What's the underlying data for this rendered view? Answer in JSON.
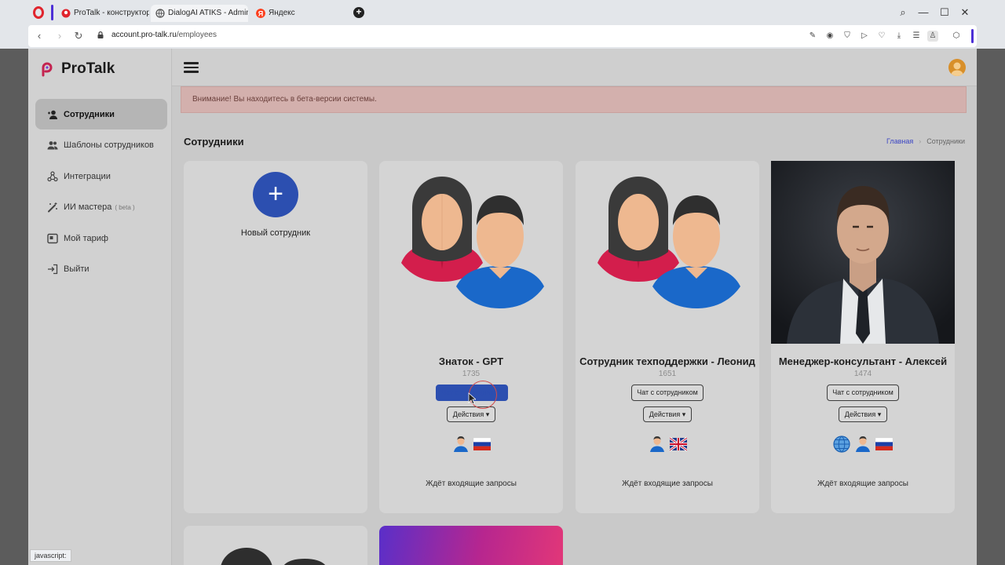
{
  "browser": {
    "tabs": [
      {
        "label": "ProTalk - конструктор GP"
      },
      {
        "label": "DialogAI ATIKS - Admin P"
      },
      {
        "label": "Яндекс"
      }
    ],
    "url_host": "account.pro-talk.ru",
    "url_path": "/employees",
    "status_text": "javascript:"
  },
  "brand": {
    "name": "ProTalk"
  },
  "sidebar": {
    "items": [
      {
        "label": "Сотрудники",
        "icon": "user-add-icon",
        "active": true
      },
      {
        "label": "Шаблоны сотрудников",
        "icon": "users-icon"
      },
      {
        "label": "Интеграции",
        "icon": "integrations-icon"
      },
      {
        "label": "ИИ мастера",
        "badge": "( beta )",
        "icon": "magic-wand-icon"
      },
      {
        "label": "Мой тариф",
        "icon": "tariff-icon"
      },
      {
        "label": "Выйти",
        "icon": "logout-icon"
      }
    ]
  },
  "alert": {
    "text": "Внимание! Вы находитесь в бета-версии системы."
  },
  "page": {
    "title": "Сотрудники",
    "breadcrumb": {
      "home": "Главная",
      "current": "Сотрудники"
    }
  },
  "new_employee": {
    "label": "Новый сотрудник"
  },
  "employees": [
    {
      "name": "Знаток - GPT",
      "id": "1735",
      "chat_label": "Чат с сотрудником",
      "actions_label": "Действия",
      "status": "Ждёт входящие запросы",
      "icons": [
        "agent-icon",
        "russian-flag-icon"
      ]
    },
    {
      "name": "Сотрудник техподдержки - Леонид",
      "id": "1651",
      "chat_label": "Чат с сотрудником",
      "actions_label": "Действия",
      "status": "Ждёт входящие запросы",
      "icons": [
        "agent-icon",
        "uk-flag-icon"
      ]
    },
    {
      "name": "Менеджер-консультант - Алексей",
      "id": "1474",
      "chat_label": "Чат с сотрудником",
      "actions_label": "Действия",
      "status": "Ждёт входящие запросы",
      "icons": [
        "globe-icon",
        "agent-icon",
        "russian-flag-icon"
      ]
    }
  ],
  "colors": {
    "primary": "#2c4fb0",
    "alert_bg": "#d3b0ad",
    "brand_red": "#e0242d",
    "accent_purple": "#4c2fd6"
  }
}
